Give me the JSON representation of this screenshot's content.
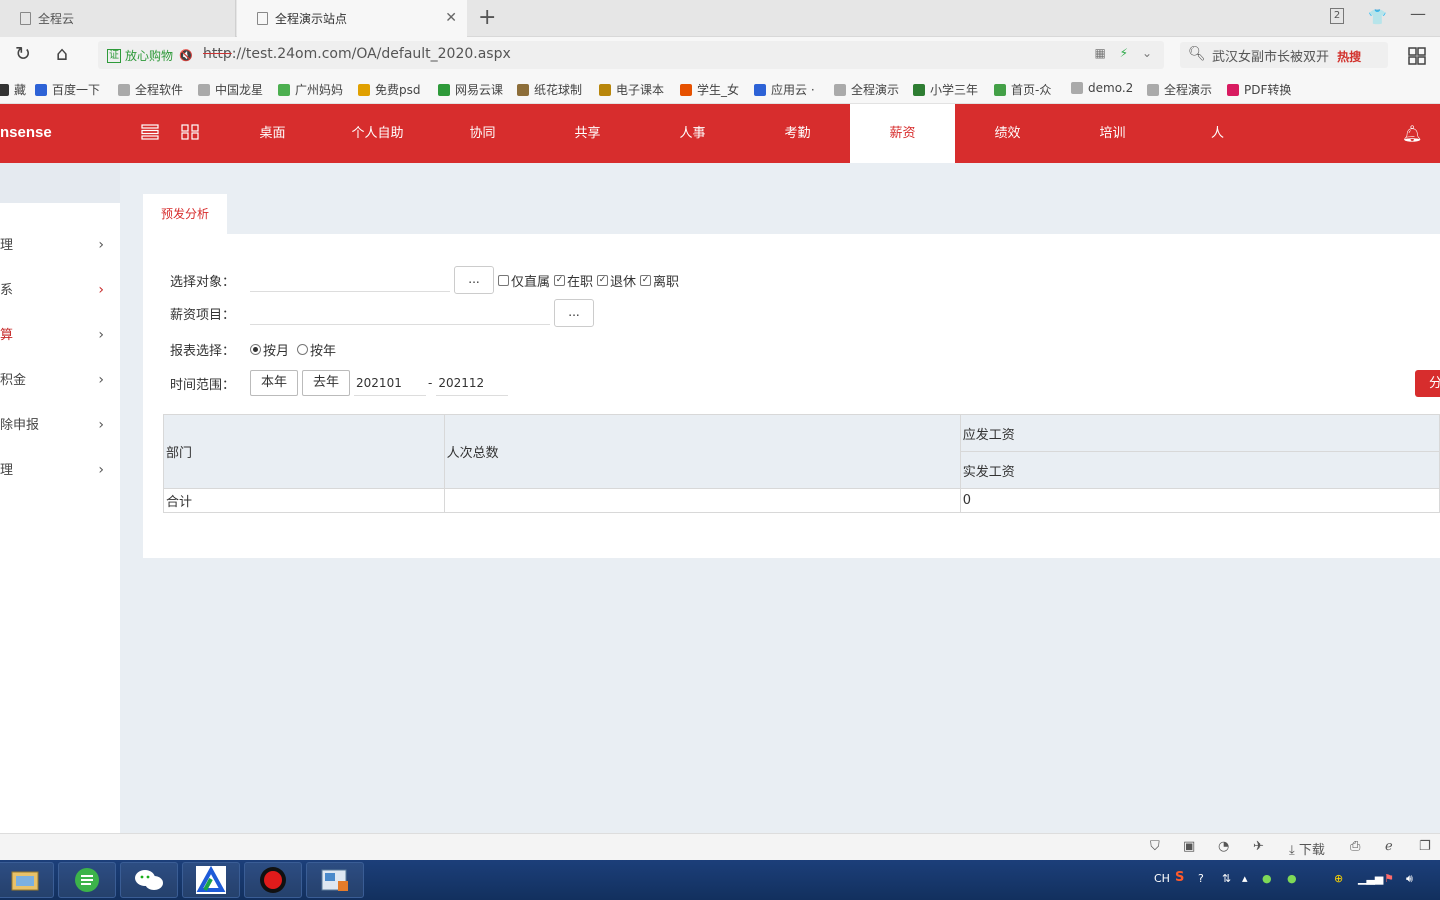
{
  "browser": {
    "tabs": [
      {
        "title": "全程云"
      },
      {
        "title": "全程演示站点"
      }
    ],
    "tab_count_badge": "2",
    "address": {
      "cert_label": "证",
      "cert_text": "放心购物",
      "protocol": "http",
      "url_rest": "://test.24om.com/OA/default_2020.aspx"
    },
    "search": {
      "text": "武汉女副市长被双开",
      "hot_label": "热搜"
    },
    "bookmarks": [
      {
        "label": "藏",
        "icon": "folder-icon",
        "color": "#333"
      },
      {
        "label": "百度一下",
        "icon": "baidu-paw-icon",
        "color": "#2d62d6"
      },
      {
        "label": "全程软件",
        "icon": "page-icon",
        "color": "#aaa"
      },
      {
        "label": "中国龙星",
        "icon": "page-icon",
        "color": "#aaa"
      },
      {
        "label": "广州妈妈",
        "icon": "leaf-icon",
        "color": "#4caf50"
      },
      {
        "label": "免费psd",
        "icon": "eye-icon",
        "color": "#e0a000"
      },
      {
        "label": "网易云课",
        "icon": "cloud-icon",
        "color": "#2e9a3a"
      },
      {
        "label": "纸花球制",
        "icon": "cube-icon",
        "color": "#8d6e3a"
      },
      {
        "label": "电子课本",
        "icon": "book-icon",
        "color": "#b8860b"
      },
      {
        "label": "学生_女",
        "icon": "90-icon",
        "color": "#e65100"
      },
      {
        "label": "应用云 ·",
        "icon": "app-icon",
        "color": "#2d62d6"
      },
      {
        "label": "全程演示",
        "icon": "page-icon",
        "color": "#aaa"
      },
      {
        "label": "小学三年",
        "icon": "green-square-icon",
        "color": "#2e7d32"
      },
      {
        "label": "首页-众",
        "icon": "green-leaf-icon",
        "color": "#43a047"
      },
      {
        "label": "demo.2",
        "icon": "page-icon",
        "color": "#aaa"
      },
      {
        "label": "全程演示",
        "icon": "page-icon",
        "color": "#aaa"
      },
      {
        "label": "PDF转换",
        "icon": "pdf-icon",
        "color": "#d81b60"
      }
    ]
  },
  "app": {
    "logo": "nsense",
    "nav": [
      "桌面",
      "个人自助",
      "协同",
      "共享",
      "人事",
      "考勤",
      "薪资",
      "绩效",
      "培训",
      "人"
    ],
    "active_nav": "薪资"
  },
  "sidebar": {
    "items": [
      {
        "label": "理"
      },
      {
        "label": "系"
      },
      {
        "label": "算"
      },
      {
        "label": "积金"
      },
      {
        "label": "除申报"
      },
      {
        "label": "理"
      }
    ]
  },
  "panel": {
    "tab": "预发分析",
    "select_target_label": "选择对象：",
    "select_btn": "...",
    "checkboxes": [
      {
        "label": "仅直属",
        "checked": false
      },
      {
        "label": "在职",
        "checked": true
      },
      {
        "label": "退休",
        "checked": true
      },
      {
        "label": "离职",
        "checked": true
      }
    ],
    "salary_item_label": "薪资项目：",
    "salary_btn": "...",
    "report_label": "报表选择：",
    "report_options": [
      {
        "label": "按月",
        "selected": true
      },
      {
        "label": "按年",
        "selected": false
      }
    ],
    "time_label": "时间范围：",
    "this_year_btn": "本年",
    "last_year_btn": "去年",
    "date_from": "202101",
    "date_sep": "-",
    "date_to": "202112",
    "analyze_btn": "分",
    "table": {
      "col_dept": "部门",
      "col_count": "人次总数",
      "col_gross": "应发工资",
      "col_net": "实发工资",
      "total_label": "合计",
      "total_count": "",
      "total_value": "0"
    }
  },
  "statusbar": {
    "download_label": "下载"
  },
  "taskbar": {
    "lang": "CH"
  },
  "colors": {
    "brand_red": "#d72d2d",
    "content_bg": "#e9eef3"
  }
}
